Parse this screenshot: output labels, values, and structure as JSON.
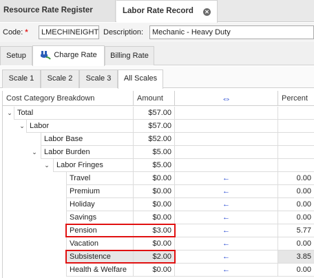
{
  "doc_tabs": [
    {
      "label": "Resource Rate Register"
    },
    {
      "label": "Labor Rate Record"
    }
  ],
  "header": {
    "code_label": "Code:",
    "required_mark": "*",
    "code_value": "LMECHINEIGHT",
    "description_label": "Description:",
    "description_value": "Mechanic - Heavy Duty"
  },
  "sub_tabs": [
    {
      "label": "Setup"
    },
    {
      "label": "Charge Rate"
    },
    {
      "label": "Billing Rate"
    }
  ],
  "scale_tabs": [
    {
      "label": "Scale 1"
    },
    {
      "label": "Scale 2"
    },
    {
      "label": "Scale 3"
    },
    {
      "label": "All Scales"
    }
  ],
  "grid": {
    "columns": {
      "category": "Cost Category Breakdown",
      "amount": "Amount",
      "arrows": "⇔",
      "percent": "Percent"
    },
    "rows": [
      {
        "name": "Total",
        "amount": "$57.00",
        "arrow": "",
        "percent": ""
      },
      {
        "name": "Labor",
        "amount": "$57.00",
        "arrow": "",
        "percent": ""
      },
      {
        "name": "Labor Base",
        "amount": "$52.00",
        "arrow": "",
        "percent": ""
      },
      {
        "name": "Labor Burden",
        "amount": "$5.00",
        "arrow": "",
        "percent": ""
      },
      {
        "name": "Labor Fringes",
        "amount": "$5.00",
        "arrow": "",
        "percent": ""
      },
      {
        "name": "Travel",
        "amount": "$0.00",
        "arrow": "←",
        "percent": "0.00"
      },
      {
        "name": "Premium",
        "amount": "$0.00",
        "arrow": "←",
        "percent": "0.00"
      },
      {
        "name": "Holiday",
        "amount": "$0.00",
        "arrow": "←",
        "percent": "0.00"
      },
      {
        "name": "Savings",
        "amount": "$0.00",
        "arrow": "←",
        "percent": "0.00"
      },
      {
        "name": "Pension",
        "amount": "$3.00",
        "arrow": "←",
        "percent": "5.77"
      },
      {
        "name": "Vacation",
        "amount": "$0.00",
        "arrow": "←",
        "percent": "0.00"
      },
      {
        "name": "Subsistence",
        "amount": "$2.00",
        "arrow": "←",
        "percent": "3.85"
      },
      {
        "name": "Health & Welfare",
        "amount": "$0.00",
        "arrow": "←",
        "percent": "0.00"
      }
    ]
  },
  "colors": {
    "highlight": "#e01010",
    "arrow": "#1a3fd0",
    "plug_icon_blue": "#2b5fb8",
    "plug_icon_green": "#3a9a3a"
  }
}
